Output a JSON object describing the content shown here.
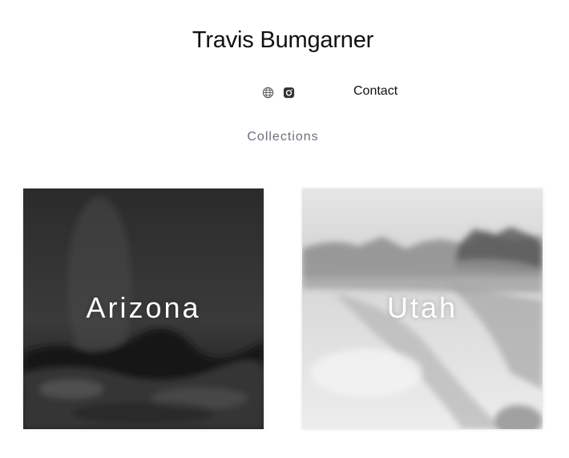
{
  "header": {
    "title": "Travis Bumgarner",
    "icons": {
      "website": "globe-icon",
      "instagram": "instagram-icon"
    },
    "nav": {
      "contact_label": "Contact"
    }
  },
  "main": {
    "section_heading": "Collections",
    "collections": [
      {
        "label": "Arizona",
        "tone": "dark"
      },
      {
        "label": "Utah",
        "tone": "light"
      }
    ]
  },
  "colors": {
    "text": "#111111",
    "heading_muted": "#6b7178",
    "overlay_text": "#ffffff"
  }
}
